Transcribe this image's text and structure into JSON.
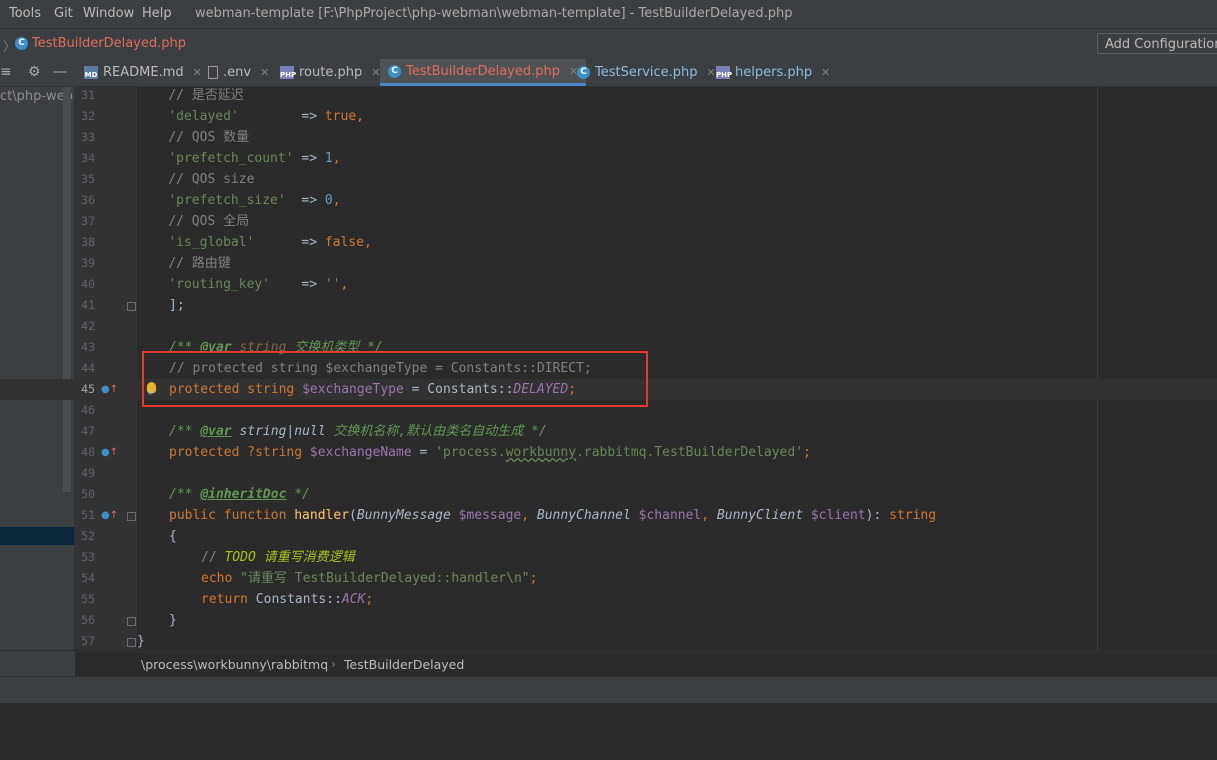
{
  "menu": {
    "tools": "Tools",
    "git": "Git",
    "window": "Window",
    "help": "Help",
    "window_title": "webman-template [F:\\PhpProject\\php-webman\\webman-template] - TestBuilderDelayed.php"
  },
  "navbar": {
    "arrow": "〉",
    "file_name": "TestBuilderDelayed.php",
    "add_configuration": "Add Configuration..."
  },
  "tabs": [
    {
      "label": "README.md",
      "icon": "markdown-file-icon",
      "icon_text": "MD"
    },
    {
      "label": ".env",
      "icon": "env-file-icon",
      "icon_text": ""
    },
    {
      "label": "route.php",
      "icon": "php-file-icon",
      "icon_text": "PHP"
    },
    {
      "label": "TestBuilderDelayed.php",
      "icon": "php-class-icon",
      "icon_text": "C"
    },
    {
      "label": "TestService.php",
      "icon": "php-class-icon",
      "icon_text": "C"
    },
    {
      "label": "helpers.php",
      "icon": "php-file-icon",
      "icon_text": "PHP"
    }
  ],
  "sidebar": {
    "path": "ct\\php-webm"
  },
  "code": {
    "line_numbers": [
      "31",
      "32",
      "33",
      "34",
      "35",
      "36",
      "37",
      "38",
      "39",
      "40",
      "41",
      "42",
      "43",
      "44",
      "45",
      "46",
      "47",
      "48",
      "49",
      "50",
      "51",
      "52",
      "53",
      "54",
      "55",
      "56",
      "57"
    ],
    "l31": {
      "comment": "// 是否延迟"
    },
    "l32": {
      "key": "'delayed'",
      "arrow": "        => ",
      "value": "true",
      "end": ","
    },
    "l33": {
      "comment": "// QOS 数量"
    },
    "l34": {
      "key": "'prefetch_count'",
      "arrow": " => ",
      "value": "1",
      "end": ","
    },
    "l35": {
      "comment": "// QOS size"
    },
    "l36": {
      "key": "'prefetch_size'",
      "arrow": "  => ",
      "value": "0",
      "end": ","
    },
    "l37": {
      "comment": "// QOS 全局"
    },
    "l38": {
      "key": "'is_global'",
      "arrow": "      => ",
      "value": "false",
      "end": ","
    },
    "l39": {
      "comment": "// 路由键"
    },
    "l40": {
      "key": "'routing_key'",
      "arrow": "    => ",
      "value": "''",
      "end": ","
    },
    "l41": {
      "text": "];"
    },
    "l43": {
      "open": "/** ",
      "tag": "@var",
      "type": " string ",
      "desc": "交换机类型 */"
    },
    "l44": {
      "comment": "// protected string $exchangeType = Constants::DIRECT;"
    },
    "l45": {
      "kw1": "protected",
      "kw2": " string ",
      "var": "$exchangeType",
      "eq": " = Constants::",
      "const": "DELAYED",
      "end": ";"
    },
    "l47": {
      "open": "/** ",
      "tag": "@var",
      "type": " string",
      "pipe": "|",
      "type2": "null ",
      "desc": "交换机名称,默认由类名自动生成 */"
    },
    "l48": {
      "kw1": "protected",
      "kw2": " ?string ",
      "var": "$exchangeName",
      "eq": " = ",
      "str1": "'process.",
      "str2": "workbunny",
      "str3": ".rabbitmq.TestBuilderDelayed'",
      "end": ";"
    },
    "l50": {
      "open": "/** ",
      "tag": "@inheritDoc",
      "close": " */"
    },
    "l51": {
      "kw1": "public function ",
      "fn": "handler",
      "p1": "(",
      "t1": "BunnyMessage",
      "v1": " $message",
      "c1": ", ",
      "t2": "BunnyChannel",
      "v2": " $channel",
      "c2": ", ",
      "t3": "BunnyClient",
      "v3": " $client",
      "p2": "): ",
      "ret": "string"
    },
    "l52": {
      "text": "{"
    },
    "l53": {
      "open": "// ",
      "todo": "TODO",
      "desc": " 请重写消费逻辑"
    },
    "l54": {
      "kw": "echo ",
      "str": "\"请重写 TestBuilderDelayed::handler\\n\"",
      "end": ";"
    },
    "l55": {
      "kw": "return ",
      "cls": "Constants::",
      "const": "ACK",
      "end": ";"
    },
    "l56": {
      "text": "}"
    },
    "l57": {
      "text": "}"
    }
  },
  "breadcrumb": {
    "namespace": "\\process\\workbunny\\rabbitmq",
    "sep": "›",
    "class": "TestBuilderDelayed"
  },
  "colors": {
    "accent": "#4a88c7",
    "highlight_box": "#e53935",
    "active_file": "#e06c5e"
  }
}
